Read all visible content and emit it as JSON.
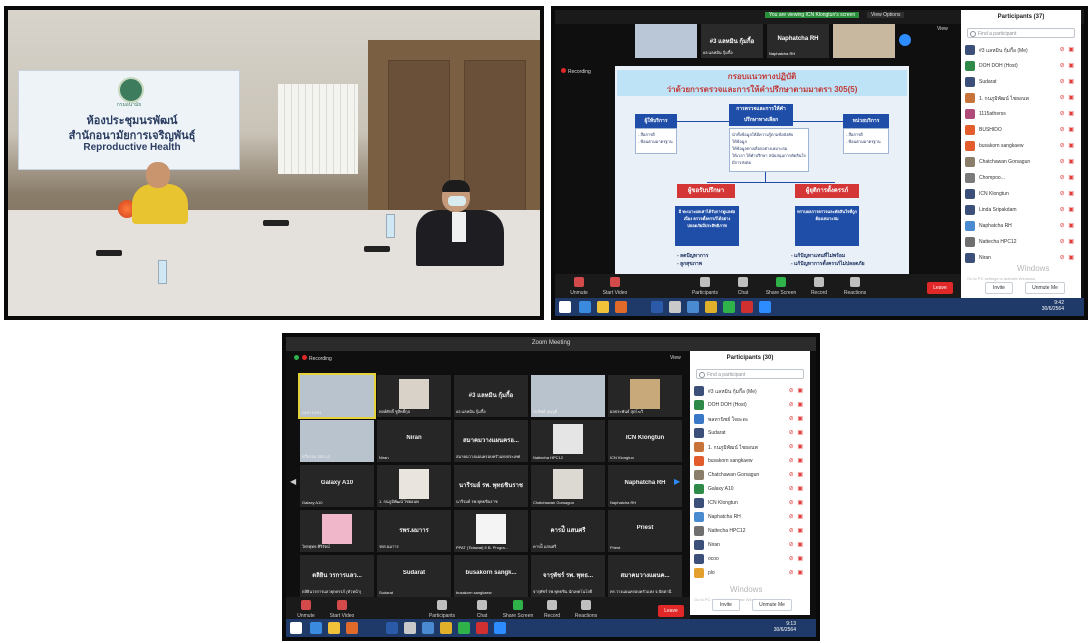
{
  "photo": {
    "banner_logo_text": "กรมอนามัย",
    "banner_line1": "ห้องประชุมนรพัฒน์",
    "banner_line2": "สำนักอนามัยการเจริญพันธุ์",
    "banner_line3": "Reproductive Health"
  },
  "zoom1": {
    "notice": "You are viewing ICN Klongtun's screen",
    "view_options": "View Options",
    "view": "View",
    "recording": "Recording",
    "participants_title": "Participants (37)",
    "search_placeholder": "Find a participant",
    "thumbs": [
      {
        "name": "#3 แลหมิน กุ้มกี้อ",
        "label": "#3 แลหมิน กุ้มกี้อ"
      },
      {
        "name": "Naphatcha RH",
        "label": "Naphatcha RH"
      }
    ],
    "participants": [
      {
        "name": "#3 แลหมิน กุ้มกี้อ (Me)",
        "color": "#3c4f78"
      },
      {
        "name": "DOH DOH (Host)",
        "color": "#2f8a4a"
      },
      {
        "name": "Sudarat",
        "color": "#3c4f78"
      },
      {
        "name": "1. กนภูมิพัฒน์ ไชยอนพ",
        "color": "#c7733a"
      },
      {
        "name": "1115atherss",
        "color": "#b04a7a"
      },
      {
        "name": "BUSHIDO",
        "color": "#e35c2c"
      },
      {
        "name": "busakorn sangkaew",
        "color": "#e35c2c"
      },
      {
        "name": "Chatchawan Gorsagun",
        "color": "#8a7d6a"
      },
      {
        "name": "Chompoo...",
        "color": "#7a7a7a"
      },
      {
        "name": "ICN Klongtun",
        "color": "#3c4f78"
      },
      {
        "name": "Linda Sripakdam",
        "color": "#3c4f78"
      },
      {
        "name": "Naphatcha RH",
        "color": "#4a8ad0"
      },
      {
        "name": "Nattecha HPC12",
        "color": "#6f6f6f"
      },
      {
        "name": "Niran",
        "color": "#3c4f78"
      }
    ],
    "invite": "Invite",
    "unmute_me": "Unmute Me",
    "watermark": "Go to PC settings to activate Windows.",
    "windows_watermark": "Windows",
    "toolbar": [
      "Unmute",
      "Start Video",
      "Participants",
      "Chat",
      "Share Screen",
      "Record",
      "Reactions"
    ],
    "leave": "Leave",
    "clock_time": "9:42",
    "clock_date": "30/6/2564"
  },
  "slide": {
    "title1": "กรอบแนวทางปฏิบัติ",
    "title2": "ว่าด้วยการตรวจและการให้คำปรึกษาตามมาตรา 305(5)",
    "center_box": "การตรวจและการให้คำปรึกษาทางเลือก",
    "left_box": "ผู้ให้บริการ",
    "left_list": [
      "- สื่อสารดี",
      "- ซ้อนตามมาตรฐาน"
    ],
    "right_box": "หน่วยบริการ",
    "right_list": [
      "- สื่อสารดี",
      "- ซ้อนตามมาตรฐาน"
    ],
    "mid_list": [
      "นำทั้งข้อมูลให้มีความรู้ตามข้อบังคับ",
      "ให้ข้อมูล",
      "ให้ข้อมูลทางเลือกอย่างเหมาะสม",
      "ให้เวลา ให้คำปรึกษา สนับสนุนการตัดสินใจ",
      "มีการส่งต่อ"
    ],
    "red_left": "ผู้ขอรับปรึกษา",
    "red_right": "ผู้ยุติการตั้งครรภ์",
    "blue_left": "มี ทะเบาะผลเค่าได้รับการดูแลต่อเนื่อง ตรวจตั้งครรภ์ได้อย่างปลอดภัยมีประสิทธิภาพ",
    "blue_right": "ทราบผลการตรวจและตัดสินใจที่ถูกต้องเหมาะสม",
    "bottom_left": [
      "- ลดปัญหาการ",
      "- ลูกสุขภาพ"
    ],
    "bottom_right": [
      "- แก้ปัญหาแทนที่ไม่พร้อม",
      "- แก้ปัญหาการตั้งครรภ์ไม่ปลอดภัย"
    ]
  },
  "zoom2": {
    "title": "Zoom Meeting",
    "recording": "Recording",
    "view": "View",
    "participants_title": "Participants (30)",
    "search_placeholder": "Find a participant",
    "tiles": [
      {
        "name": "",
        "label": "DOH DOH",
        "pic": "room"
      },
      {
        "name": "",
        "label": "พงษ์ศักดิ์ ชูสิทธิ์กุล",
        "pic": "man"
      },
      {
        "name": "#3 แลหมิน กุ้มกี้อ",
        "label": "#3 แลหมิน กุ้มกี้อ",
        "pic": ""
      },
      {
        "name": "",
        "label": "พรทิพย์ บุญจูดี",
        "pic": "room"
      },
      {
        "name": "",
        "label": "ผลประพันธ์ สุดโฆวี",
        "pic": "person"
      },
      {
        "name": "",
        "label": "ทวีธรรม สสจ.12",
        "pic": "room"
      },
      {
        "name": "Niran",
        "label": "Niran",
        "pic": ""
      },
      {
        "name": "สมาคมวางแผนครอ...",
        "label": "สมาคมวางแผนครอบครัวแห่งประเทศ",
        "pic": ""
      },
      {
        "name": "",
        "label": "Nattecha HPC12",
        "pic": "doc"
      },
      {
        "name": "ICN Klongtun",
        "label": "ICN Klongtun",
        "pic": ""
      },
      {
        "name": "Galaxy A10",
        "label": "Galaxy A10",
        "pic": ""
      },
      {
        "name": "",
        "label": "1. กนภูมิพัฒน์ ไชยอนพ",
        "pic": "woman"
      },
      {
        "name": "นารีรมย์ รพ. พุทธชินราช",
        "label": "นารีรมย์ รพ.พุทธชินราช",
        "pic": ""
      },
      {
        "name": "",
        "label": "Chatchawan Gorsagun",
        "pic": "man2"
      },
      {
        "name": "Naphatcha RH",
        "label": "Naphatcha RH",
        "pic": ""
      },
      {
        "name": "",
        "label": "ไพรพุทธ ศิริรัตน์",
        "pic": "pink"
      },
      {
        "name": "รพร.ผมาาร",
        "label": "รพร.ผมาาร",
        "pic": ""
      },
      {
        "name": "",
        "label": "PPAT (Tidawat) 5 B. Progra...",
        "pic": "logo"
      },
      {
        "name": "คารม์ี แสนศรี",
        "label": "คารม์ี แสนศรี",
        "pic": ""
      },
      {
        "name": "Priest",
        "label": "Priest",
        "pic": ""
      },
      {
        "name": "ดลิยิน วรการแลว...",
        "label": "ดลิยินวรการแลวยุกครรภ์ (หัวหน้า)",
        "pic": ""
      },
      {
        "name": "Sudarat",
        "label": "Sudarat",
        "pic": ""
      },
      {
        "name": "busakorn sangk...",
        "label": "busakorn sangkaew",
        "pic": ""
      },
      {
        "name": "จารุพัชร์ รพ. พุทธ...",
        "label": "จารุพัชร์ รพ.พุทธชิน นักเทคโนโลยี",
        "pic": ""
      },
      {
        "name": "สมาคมวางแผนค...",
        "label": "คร.วางแผนครอบครัวแห่ง จ.ปัตตานี",
        "pic": ""
      }
    ],
    "participants": [
      {
        "name": "#3 แลหมิน กุ้มกี้อ (Me)",
        "color": "#3c4f78"
      },
      {
        "name": "DOH DOH (Host)",
        "color": "#2f8a4a"
      },
      {
        "name": "พลทานิชย์ ใจยะดะ",
        "color": "#3c78c8"
      },
      {
        "name": "Sudarat",
        "color": "#3c4f78"
      },
      {
        "name": "1. กนภูมิพัฒน์ ไชยอนพ",
        "color": "#c7733a"
      },
      {
        "name": "busakorn sangkaew",
        "color": "#e35c2c"
      },
      {
        "name": "Chatchawan Gorsagun",
        "color": "#8a7d6a"
      },
      {
        "name": "Galaxy A10",
        "color": "#2f8a4a"
      },
      {
        "name": "ICN Klongtun",
        "color": "#3c4f78"
      },
      {
        "name": "Naphatcha RH",
        "color": "#4a8ad0"
      },
      {
        "name": "Nattecha HPC12",
        "color": "#6f6f6f"
      },
      {
        "name": "Niran",
        "color": "#3c4f78"
      },
      {
        "name": "ocoo",
        "color": "#3c4f78"
      },
      {
        "name": "plo",
        "color": "#e3a02c"
      }
    ],
    "invite": "Invite",
    "unmute_me": "Unmute Me",
    "watermark": "Go to PC settings to activate Windows.",
    "windows_watermark": "Windows",
    "toolbar": [
      "Unmute",
      "Start Video",
      "Participants",
      "Chat",
      "Share Screen",
      "Record",
      "Reactions"
    ],
    "leave": "Leave",
    "clock_time": "9:13",
    "clock_date": "30/6/2564"
  }
}
